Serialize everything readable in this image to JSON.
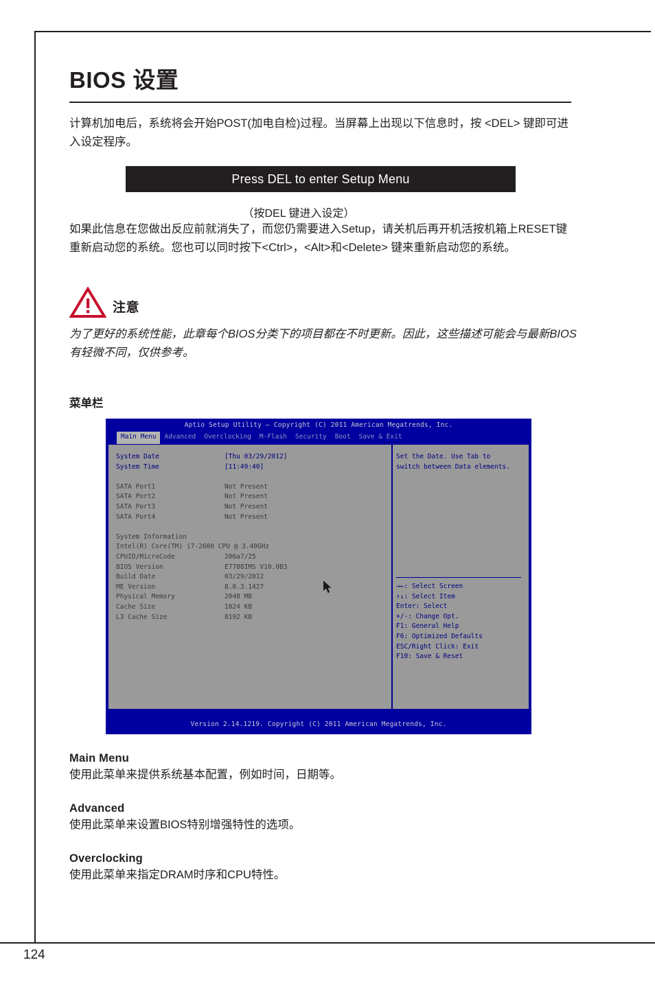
{
  "page": {
    "number": "124",
    "title": "BIOS 设置"
  },
  "intro": {
    "paragraph1": "计算机加电后，系统将会开始POST(加电自检)过程。当屏幕上出现以下信息时，按 <DEL> 键即可进入设定程序。",
    "post_banner": "Press DEL to enter Setup Menu",
    "post_caption": "（按DEL 键进入设定）",
    "paragraph2": "如果此信息在您做出反应前就消失了，而您仍需要进入Setup，请关机后再开机活按机箱上RESET键重新启动您的系统。您也可以同时按下<Ctrl>，<Alt>和<Delete> 键来重新启动您的系统。"
  },
  "note": {
    "icon": "warning-triangle-icon",
    "label": "注意",
    "text": "为了更好的系统性能，此章每个BIOS分类下的项目都在不时更新。因此，这些描述可能会与最新BIOS有轻微不同，仅供参考。",
    "accent_color": "#c8102e"
  },
  "menu_bar_section": {
    "label": "菜单栏"
  },
  "bios": {
    "title": "Aptio Setup Utility – Copyright (C) 2011 American Megatrends, Inc.",
    "footer": "Version 2.14.1219. Copyright (C) 2011 American Megatrends, Inc.",
    "tabs": [
      {
        "label": "Main Menu",
        "active": true
      },
      {
        "label": "Advanced",
        "active": false
      },
      {
        "label": "Overclocking",
        "active": false
      },
      {
        "label": "M-Flash",
        "active": false
      },
      {
        "label": "Security",
        "active": false
      },
      {
        "label": "Boot",
        "active": false
      },
      {
        "label": "Save & Exit",
        "active": false
      }
    ],
    "settings": [
      {
        "label": "System Date",
        "value": "[Thu 03/29/2012]",
        "style": "blue"
      },
      {
        "label": "System Time",
        "value": "[11:49:40]",
        "style": "blue"
      }
    ],
    "sata": [
      {
        "label": "SATA Port1",
        "value": "Not Present"
      },
      {
        "label": "SATA Port2",
        "value": "Not Present"
      },
      {
        "label": "SATA Port3",
        "value": "Not Present"
      },
      {
        "label": "SATA Port4",
        "value": "Not Present"
      }
    ],
    "system_information": {
      "heading": "System Information",
      "cpu": "Intel(R) Core(TM) i7-2600 CPU @ 3.40GHz",
      "rows": [
        {
          "label": "CPUID/MicroCode",
          "value": "206a7/25"
        },
        {
          "label": "BIOS Version",
          "value": "E7788IMS V10.0B3"
        },
        {
          "label": "Build Date",
          "value": "03/29/2012"
        },
        {
          "label": "ME Version",
          "value": "8.0.3.1427"
        },
        {
          "label": "Physical Memory",
          "value": "2048 MB"
        },
        {
          "label": "Cache Size",
          "value": "1024 KB"
        },
        {
          "label": "L3 Cache Size",
          "value": "8192 KB"
        }
      ]
    },
    "help": {
      "line1": "Set the Date. Use Tab to",
      "line2": "switch between Data elements."
    },
    "keys": [
      "→←: Select Screen",
      "↑↓: Select Item",
      "Enter: Select",
      "+/-: Change Opt.",
      "F1: General Help",
      "F6: Optimized Defaults",
      "ESC/Right Click: Exit",
      "F10: Save & Reset"
    ],
    "colors": {
      "chrome": "#0000a0",
      "panel": "#9a9a9a",
      "accent_text": "#000080",
      "active_tab_bg": "#b4b4b4"
    }
  },
  "descriptions": [
    {
      "title": "Main Menu",
      "text": "使用此菜单来提供系统基本配置，例如时间，日期等。"
    },
    {
      "title": "Advanced",
      "text": "使用此菜单来设置BIOS特别增强特性的选项。"
    },
    {
      "title": "Overclocking",
      "text": "使用此菜单来指定DRAM时序和CPU特性。"
    }
  ]
}
